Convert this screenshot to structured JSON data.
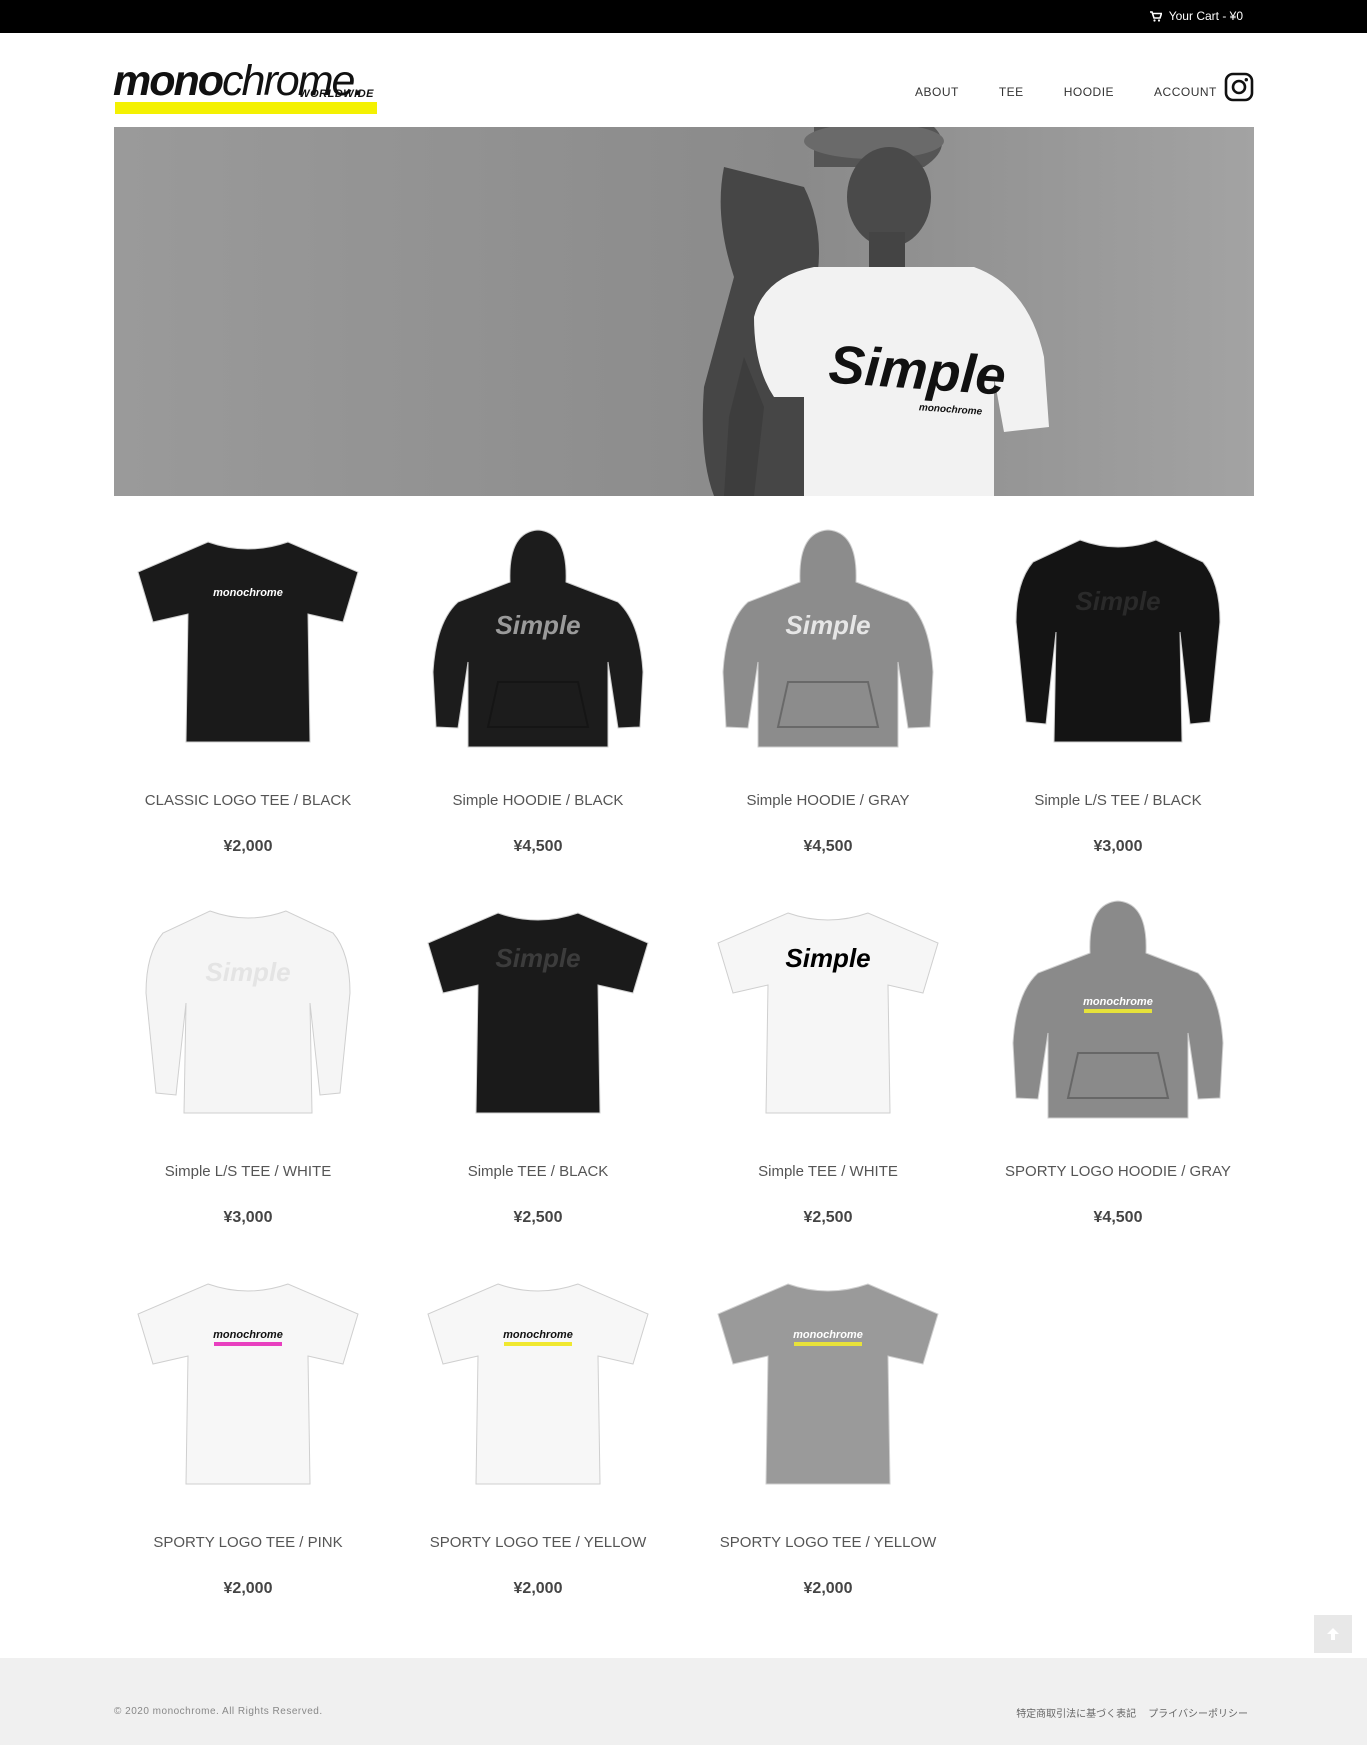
{
  "topbar": {
    "cart_label": "Your Cart - ¥0"
  },
  "brand": {
    "name_bold": "mono",
    "name_light": "chrome.",
    "tagline": "WORLDWIDE",
    "accent": "#f4f102"
  },
  "nav": {
    "items": [
      "ABOUT",
      "TEE",
      "HOODIE",
      "ACCOUNT"
    ],
    "instagram_icon": "instagram-icon"
  },
  "hero": {
    "shirt_text": "Simple",
    "shirt_subtext": "monochrome"
  },
  "products": [
    {
      "name": "CLASSIC LOGO TEE / BLACK",
      "price": "¥2,000",
      "kind": "tee",
      "color": "#1a1a1a",
      "print": "monochrome",
      "print_color": "#ffffff",
      "stripe": ""
    },
    {
      "name": "Simple HOODIE / BLACK",
      "price": "¥4,500",
      "kind": "hoodie",
      "color": "#1c1c1c",
      "print": "Simple",
      "print_color": "#9a9a9a",
      "stripe": ""
    },
    {
      "name": "Simple HOODIE / GRAY",
      "price": "¥4,500",
      "kind": "hoodie",
      "color": "#8c8c8c",
      "print": "Simple",
      "print_color": "#e6e6e6",
      "stripe": ""
    },
    {
      "name": "Simple L/S TEE / BLACK",
      "price": "¥3,000",
      "kind": "longsleeve",
      "color": "#141414",
      "print": "Simple",
      "print_color": "#2a2a2a",
      "stripe": ""
    },
    {
      "name": "Simple L/S TEE / WHITE",
      "price": "¥3,000",
      "kind": "longsleeve",
      "color": "#f5f5f5",
      "print": "Simple",
      "print_color": "#e4e4e4",
      "stripe": ""
    },
    {
      "name": "Simple TEE / BLACK",
      "price": "¥2,500",
      "kind": "tee",
      "color": "#1a1a1a",
      "print": "Simple",
      "print_color": "#3c3c3c",
      "stripe": ""
    },
    {
      "name": "Simple TEE / WHITE",
      "price": "¥2,500",
      "kind": "tee",
      "color": "#f6f6f6",
      "print": "Simple",
      "print_color": "#000000",
      "stripe": ""
    },
    {
      "name": "SPORTY LOGO HOODIE / GRAY",
      "price": "¥4,500",
      "kind": "hoodie",
      "color": "#8a8a8a",
      "print": "monochrome",
      "print_color": "#ffffff",
      "stripe": "#e6e23a"
    },
    {
      "name": "SPORTY LOGO TEE / PINK",
      "price": "¥2,000",
      "kind": "tee",
      "color": "#f7f7f7",
      "print": "monochrome",
      "print_color": "#111111",
      "stripe": "#e83fbf"
    },
    {
      "name": "SPORTY LOGO TEE / YELLOW",
      "price": "¥2,000",
      "kind": "tee",
      "color": "#f7f7f7",
      "print": "monochrome",
      "print_color": "#111111",
      "stripe": "#f0e830"
    },
    {
      "name": "SPORTY LOGO TEE / YELLOW",
      "price": "¥2,000",
      "kind": "tee",
      "color": "#9a9a9a",
      "print": "monochrome",
      "print_color": "#ffffff",
      "stripe": "#e8e23a"
    }
  ],
  "footer": {
    "copyright": "© 2020 monochrome. All Rights Reserved.",
    "links": [
      "特定商取引法に基づく表記",
      "プライバシーポリシー"
    ]
  }
}
